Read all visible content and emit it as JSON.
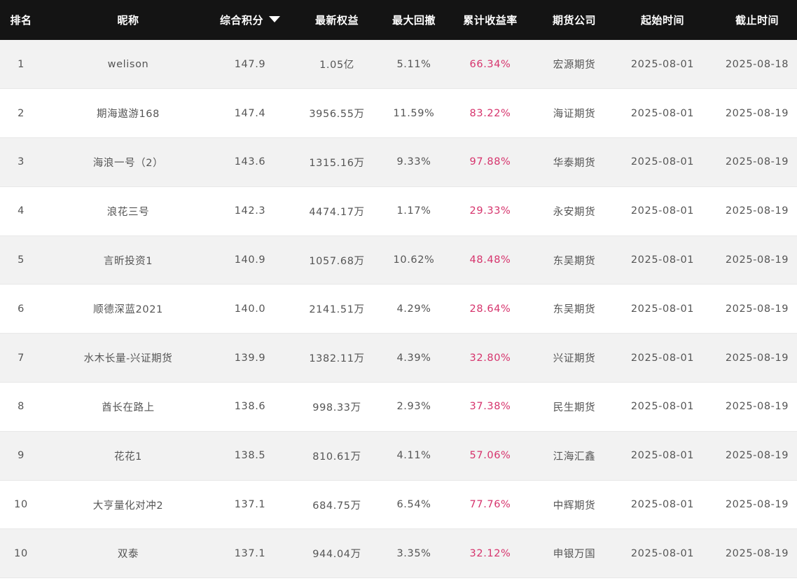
{
  "table": {
    "headers": {
      "rank": "排名",
      "nickname": "昵称",
      "score": "综合积分",
      "equity": "最新权益",
      "max_drawdown": "最大回撤",
      "cumulative_return": "累计收益率",
      "company": "期货公司",
      "start_date": "起始时间",
      "end_date": "截止时间"
    },
    "sort": {
      "column": "score",
      "direction": "desc",
      "icon": "caret-down-icon"
    },
    "accent_color": "#d6336c",
    "header_bg": "#141414",
    "rows": [
      {
        "rank": "1",
        "nickname": "welison",
        "score": "147.9",
        "equity": "1.05亿",
        "max_drawdown": "5.11%",
        "cumulative_return": "66.34%",
        "company": "宏源期货",
        "start_date": "2025-08-01",
        "end_date": "2025-08-18"
      },
      {
        "rank": "2",
        "nickname": "期海遨游168",
        "score": "147.4",
        "equity": "3956.55万",
        "max_drawdown": "11.59%",
        "cumulative_return": "83.22%",
        "company": "海证期货",
        "start_date": "2025-08-01",
        "end_date": "2025-08-19"
      },
      {
        "rank": "3",
        "nickname": "海浪一号（2）",
        "score": "143.6",
        "equity": "1315.16万",
        "max_drawdown": "9.33%",
        "cumulative_return": "97.88%",
        "company": "华泰期货",
        "start_date": "2025-08-01",
        "end_date": "2025-08-19"
      },
      {
        "rank": "4",
        "nickname": "浪花三号",
        "score": "142.3",
        "equity": "4474.17万",
        "max_drawdown": "1.17%",
        "cumulative_return": "29.33%",
        "company": "永安期货",
        "start_date": "2025-08-01",
        "end_date": "2025-08-19"
      },
      {
        "rank": "5",
        "nickname": "言昕投资1",
        "score": "140.9",
        "equity": "1057.68万",
        "max_drawdown": "10.62%",
        "cumulative_return": "48.48%",
        "company": "东吴期货",
        "start_date": "2025-08-01",
        "end_date": "2025-08-19"
      },
      {
        "rank": "6",
        "nickname": "顺德深蓝2021",
        "score": "140.0",
        "equity": "2141.51万",
        "max_drawdown": "4.29%",
        "cumulative_return": "28.64%",
        "company": "东吴期货",
        "start_date": "2025-08-01",
        "end_date": "2025-08-19"
      },
      {
        "rank": "7",
        "nickname": "水木长量-兴证期货",
        "score": "139.9",
        "equity": "1382.11万",
        "max_drawdown": "4.39%",
        "cumulative_return": "32.80%",
        "company": "兴证期货",
        "start_date": "2025-08-01",
        "end_date": "2025-08-19"
      },
      {
        "rank": "8",
        "nickname": "酋长在路上",
        "score": "138.6",
        "equity": "998.33万",
        "max_drawdown": "2.93%",
        "cumulative_return": "37.38%",
        "company": "民生期货",
        "start_date": "2025-08-01",
        "end_date": "2025-08-19"
      },
      {
        "rank": "9",
        "nickname": "花花1",
        "score": "138.5",
        "equity": "810.61万",
        "max_drawdown": "4.11%",
        "cumulative_return": "57.06%",
        "company": "江海汇鑫",
        "start_date": "2025-08-01",
        "end_date": "2025-08-19"
      },
      {
        "rank": "10",
        "nickname": "大亨量化对冲2",
        "score": "137.1",
        "equity": "684.75万",
        "max_drawdown": "6.54%",
        "cumulative_return": "77.76%",
        "company": "中辉期货",
        "start_date": "2025-08-01",
        "end_date": "2025-08-19"
      },
      {
        "rank": "10",
        "nickname": "双泰",
        "score": "137.1",
        "equity": "944.04万",
        "max_drawdown": "3.35%",
        "cumulative_return": "32.12%",
        "company": "申银万国",
        "start_date": "2025-08-01",
        "end_date": "2025-08-19"
      }
    ]
  }
}
